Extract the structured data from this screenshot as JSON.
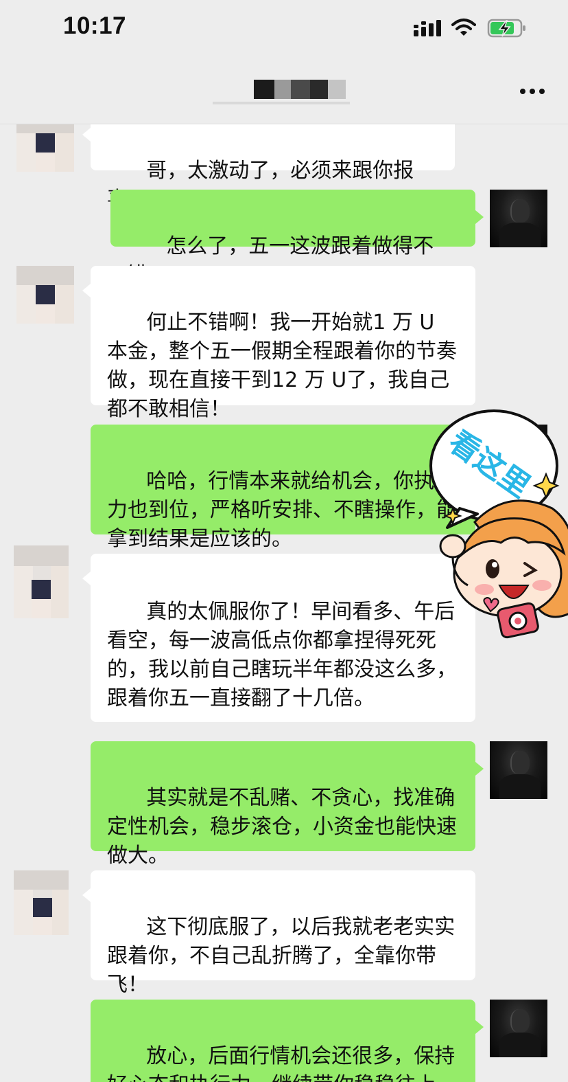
{
  "status_bar": {
    "time": "10:17",
    "icons": [
      "signal-icon",
      "wifi-icon",
      "battery-charging-icon"
    ]
  },
  "nav": {
    "title": "",
    "more_icon": "more-icon"
  },
  "messages": [
    {
      "side": "left",
      "text": "哥，太激动了，必须来跟你报喜！"
    },
    {
      "side": "right",
      "text": "怎么了，五一这波跟着做得不错?"
    },
    {
      "side": "left",
      "text": "何止不错啊！我一开始就1 万 U 本金，整个五一假期全程跟着你的节奏做，现在直接干到12 万 U了，我自己都不敢相信！"
    },
    {
      "side": "right",
      "text": "哈哈，行情本来就给机会，你执行力也到位，严格听安排、不瞎操作，能拿到结果是应该的。"
    },
    {
      "side": "left",
      "text": "真的太佩服你了！早间看多、午后看空，每一波高低点你都拿捏得死死的，我以前自己瞎玩半年都没这么多，跟着你五一直接翻了十几倍。"
    },
    {
      "side": "right",
      "text": "其实就是不乱赌、不贪心，找准确定性机会，稳步滚仓，小资金也能快速做大。"
    },
    {
      "side": "left",
      "text": "这下彻底服了，以后我就老老实实跟着你，不自己乱折腾了，全靠你带飞！"
    },
    {
      "side": "right",
      "text": "放心，后面行情机会还很多，保持好心态和执行力，继续带你稳稳往上冲。"
    }
  ],
  "sticker": {
    "text": "看这里",
    "icons": [
      "camera-icon",
      "heart-icon",
      "sparkle-icon"
    ]
  },
  "colors": {
    "background": "#ededed",
    "bubble_right": "#95ec69",
    "bubble_left": "#ffffff",
    "sticker_text": "#29b6e6"
  }
}
